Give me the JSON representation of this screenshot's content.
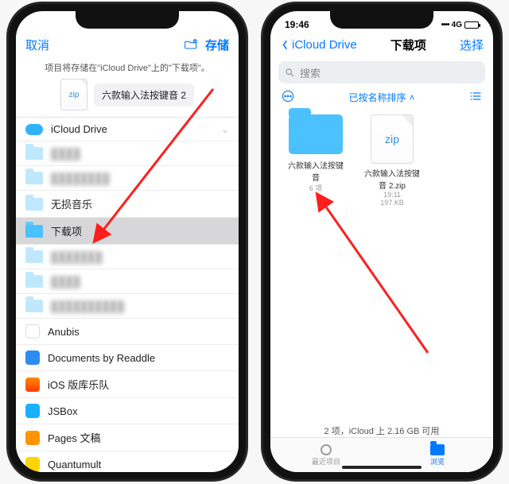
{
  "left": {
    "nav": {
      "cancel": "取消",
      "save": "存储"
    },
    "hint": "项目将存储在\"iCloud Drive\"上的\"下载项\"。",
    "file": {
      "badge": "zip",
      "name": "六款输入法按键音 2"
    },
    "root": {
      "title": "iCloud Drive"
    },
    "rows": {
      "r0": "████",
      "r1": "████████",
      "r2": "无损音乐",
      "r3": "下载项",
      "r4": "███████",
      "r5": "████",
      "r6": "██████████",
      "r7": "Anubis",
      "r8": "Documents by Readdle",
      "r9": "iOS 版库乐队",
      "r10": "JSBox",
      "r11": "Pages 文稿",
      "r12": "Quantumult"
    }
  },
  "right": {
    "status": {
      "time": "19:46",
      "net": "4G"
    },
    "nav": {
      "back": "iCloud Drive",
      "title": "下载项",
      "select": "选择"
    },
    "search_placeholder": "搜索",
    "sort_label": "已按名称排序",
    "items": {
      "folder": {
        "name": "六款输入法按键音",
        "sub": "6 项"
      },
      "zip": {
        "name": "六款输入法按键音 2.zip",
        "time": "19:11",
        "size": "197 KB",
        "badge": "zip"
      }
    },
    "bottom_status": "2 项，iCloud 上 2.16 GB 可用",
    "tabs": {
      "recent": "最近项目",
      "browse": "浏览"
    }
  }
}
